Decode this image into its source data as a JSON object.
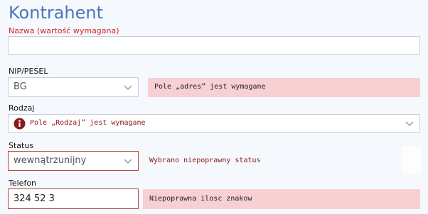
{
  "form": {
    "title": "Kontrahent",
    "nazwa": {
      "label": "Nazwa (wartość wymagana)",
      "value": ""
    },
    "nip_pesel": {
      "label": "NIP/PESEL",
      "selected": "BG",
      "icon": "chevron-down-icon",
      "error": "Pole „adres” jest wymagane"
    },
    "rodzaj": {
      "label": "Rodzaj",
      "icon": "info-icon",
      "error": "Pole „Rodzaj” jest wymagane",
      "chevron": "chevron-down-icon"
    },
    "status": {
      "label": "Status",
      "selected": "wewnątrzunijny",
      "error": "Wybrano niepoprawny status"
    },
    "telefon": {
      "label": "Telefon",
      "value": "324 52 3",
      "error": "Niepoprawna ilosc znakow"
    }
  },
  "colors": {
    "title": "#4a76b8",
    "required_label": "#d02828",
    "error_box": "#f8cfd3",
    "error_text": "#8b1a1a",
    "error_border": "#b04a3c"
  }
}
